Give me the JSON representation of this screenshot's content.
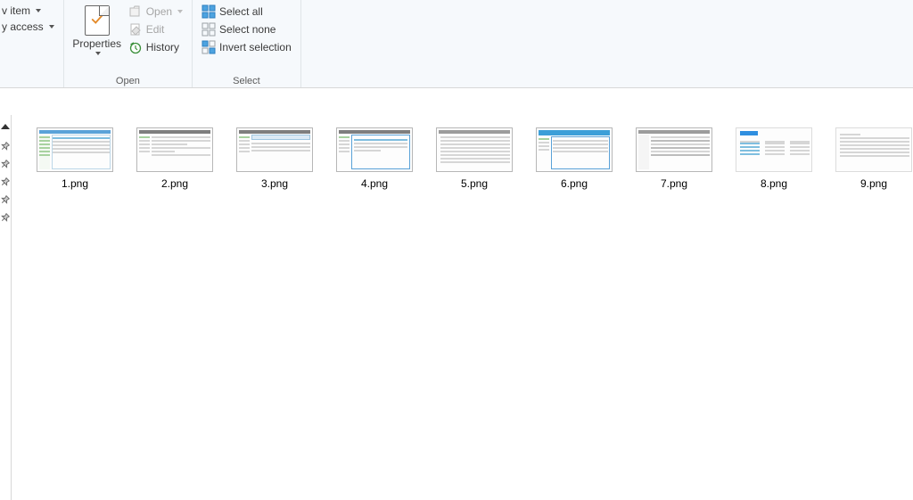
{
  "ribbon": {
    "new_group": {
      "new_item_label": "v item",
      "easy_access_label": "y access"
    },
    "open_group": {
      "properties_label": "Properties",
      "open_label": "Open",
      "edit_label": "Edit",
      "history_label": "History",
      "group_label": "Open"
    },
    "select_group": {
      "select_all_label": "Select all",
      "select_none_label": "Select none",
      "invert_label": "Invert selection",
      "group_label": "Select"
    }
  },
  "files": [
    {
      "name": "1.png"
    },
    {
      "name": "2.png"
    },
    {
      "name": "3.png"
    },
    {
      "name": "4.png"
    },
    {
      "name": "5.png"
    },
    {
      "name": "6.png"
    },
    {
      "name": "7.png"
    },
    {
      "name": "8.png"
    },
    {
      "name": "9.png"
    }
  ]
}
